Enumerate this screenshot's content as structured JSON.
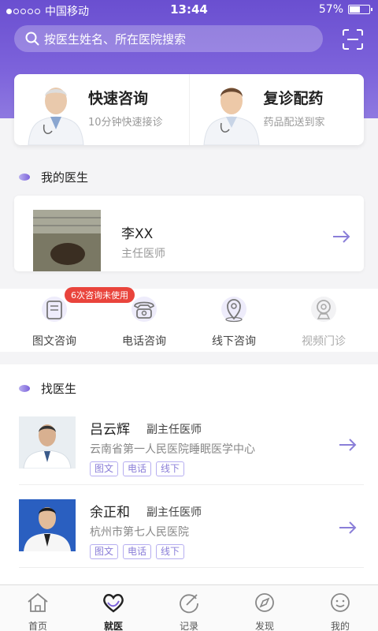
{
  "status_bar": {
    "carrier": "中国移动",
    "time": "13:44",
    "battery": "57%",
    "battery_level": 0.57
  },
  "search": {
    "placeholder": "按医生姓名、所在医院搜索"
  },
  "services": [
    {
      "title": "快速咨询",
      "subtitle": "10分钟快速接诊"
    },
    {
      "title": "复诊配药",
      "subtitle": "药品配送到家"
    }
  ],
  "my_doctor": {
    "section_title": "我的医生",
    "name": "李XX",
    "title": "主任医师"
  },
  "consult_options": {
    "badge": "6次咨询未使用",
    "items": [
      {
        "label": "图文咨询",
        "icon": "chat-text-icon"
      },
      {
        "label": "电话咨询",
        "icon": "phone-icon"
      },
      {
        "label": "线下咨询",
        "icon": "location-icon"
      },
      {
        "label": "视频门诊",
        "icon": "video-camera-icon"
      }
    ]
  },
  "find_doctor": {
    "section_title": "找医生",
    "doctors": [
      {
        "name": "吕云辉",
        "level": "副主任医师",
        "hospital": "云南省第一人民医院睡眠医学中心",
        "tags": [
          "图文",
          "电话",
          "线下"
        ]
      },
      {
        "name": "余正和",
        "level": "副主任医师",
        "hospital": "杭州市第七人民医院",
        "tags": [
          "图文",
          "电话",
          "线下"
        ]
      }
    ]
  },
  "tab_bar": {
    "tabs": [
      {
        "label": "首页",
        "icon": "home-icon"
      },
      {
        "label": "就医",
        "icon": "heart-stethoscope-icon"
      },
      {
        "label": "记录",
        "icon": "record-icon"
      },
      {
        "label": "发现",
        "icon": "compass-icon"
      },
      {
        "label": "我的",
        "icon": "smile-icon"
      }
    ],
    "active": "就医"
  },
  "colors": {
    "brand": "#7d63db",
    "badge": "#e9443c"
  }
}
